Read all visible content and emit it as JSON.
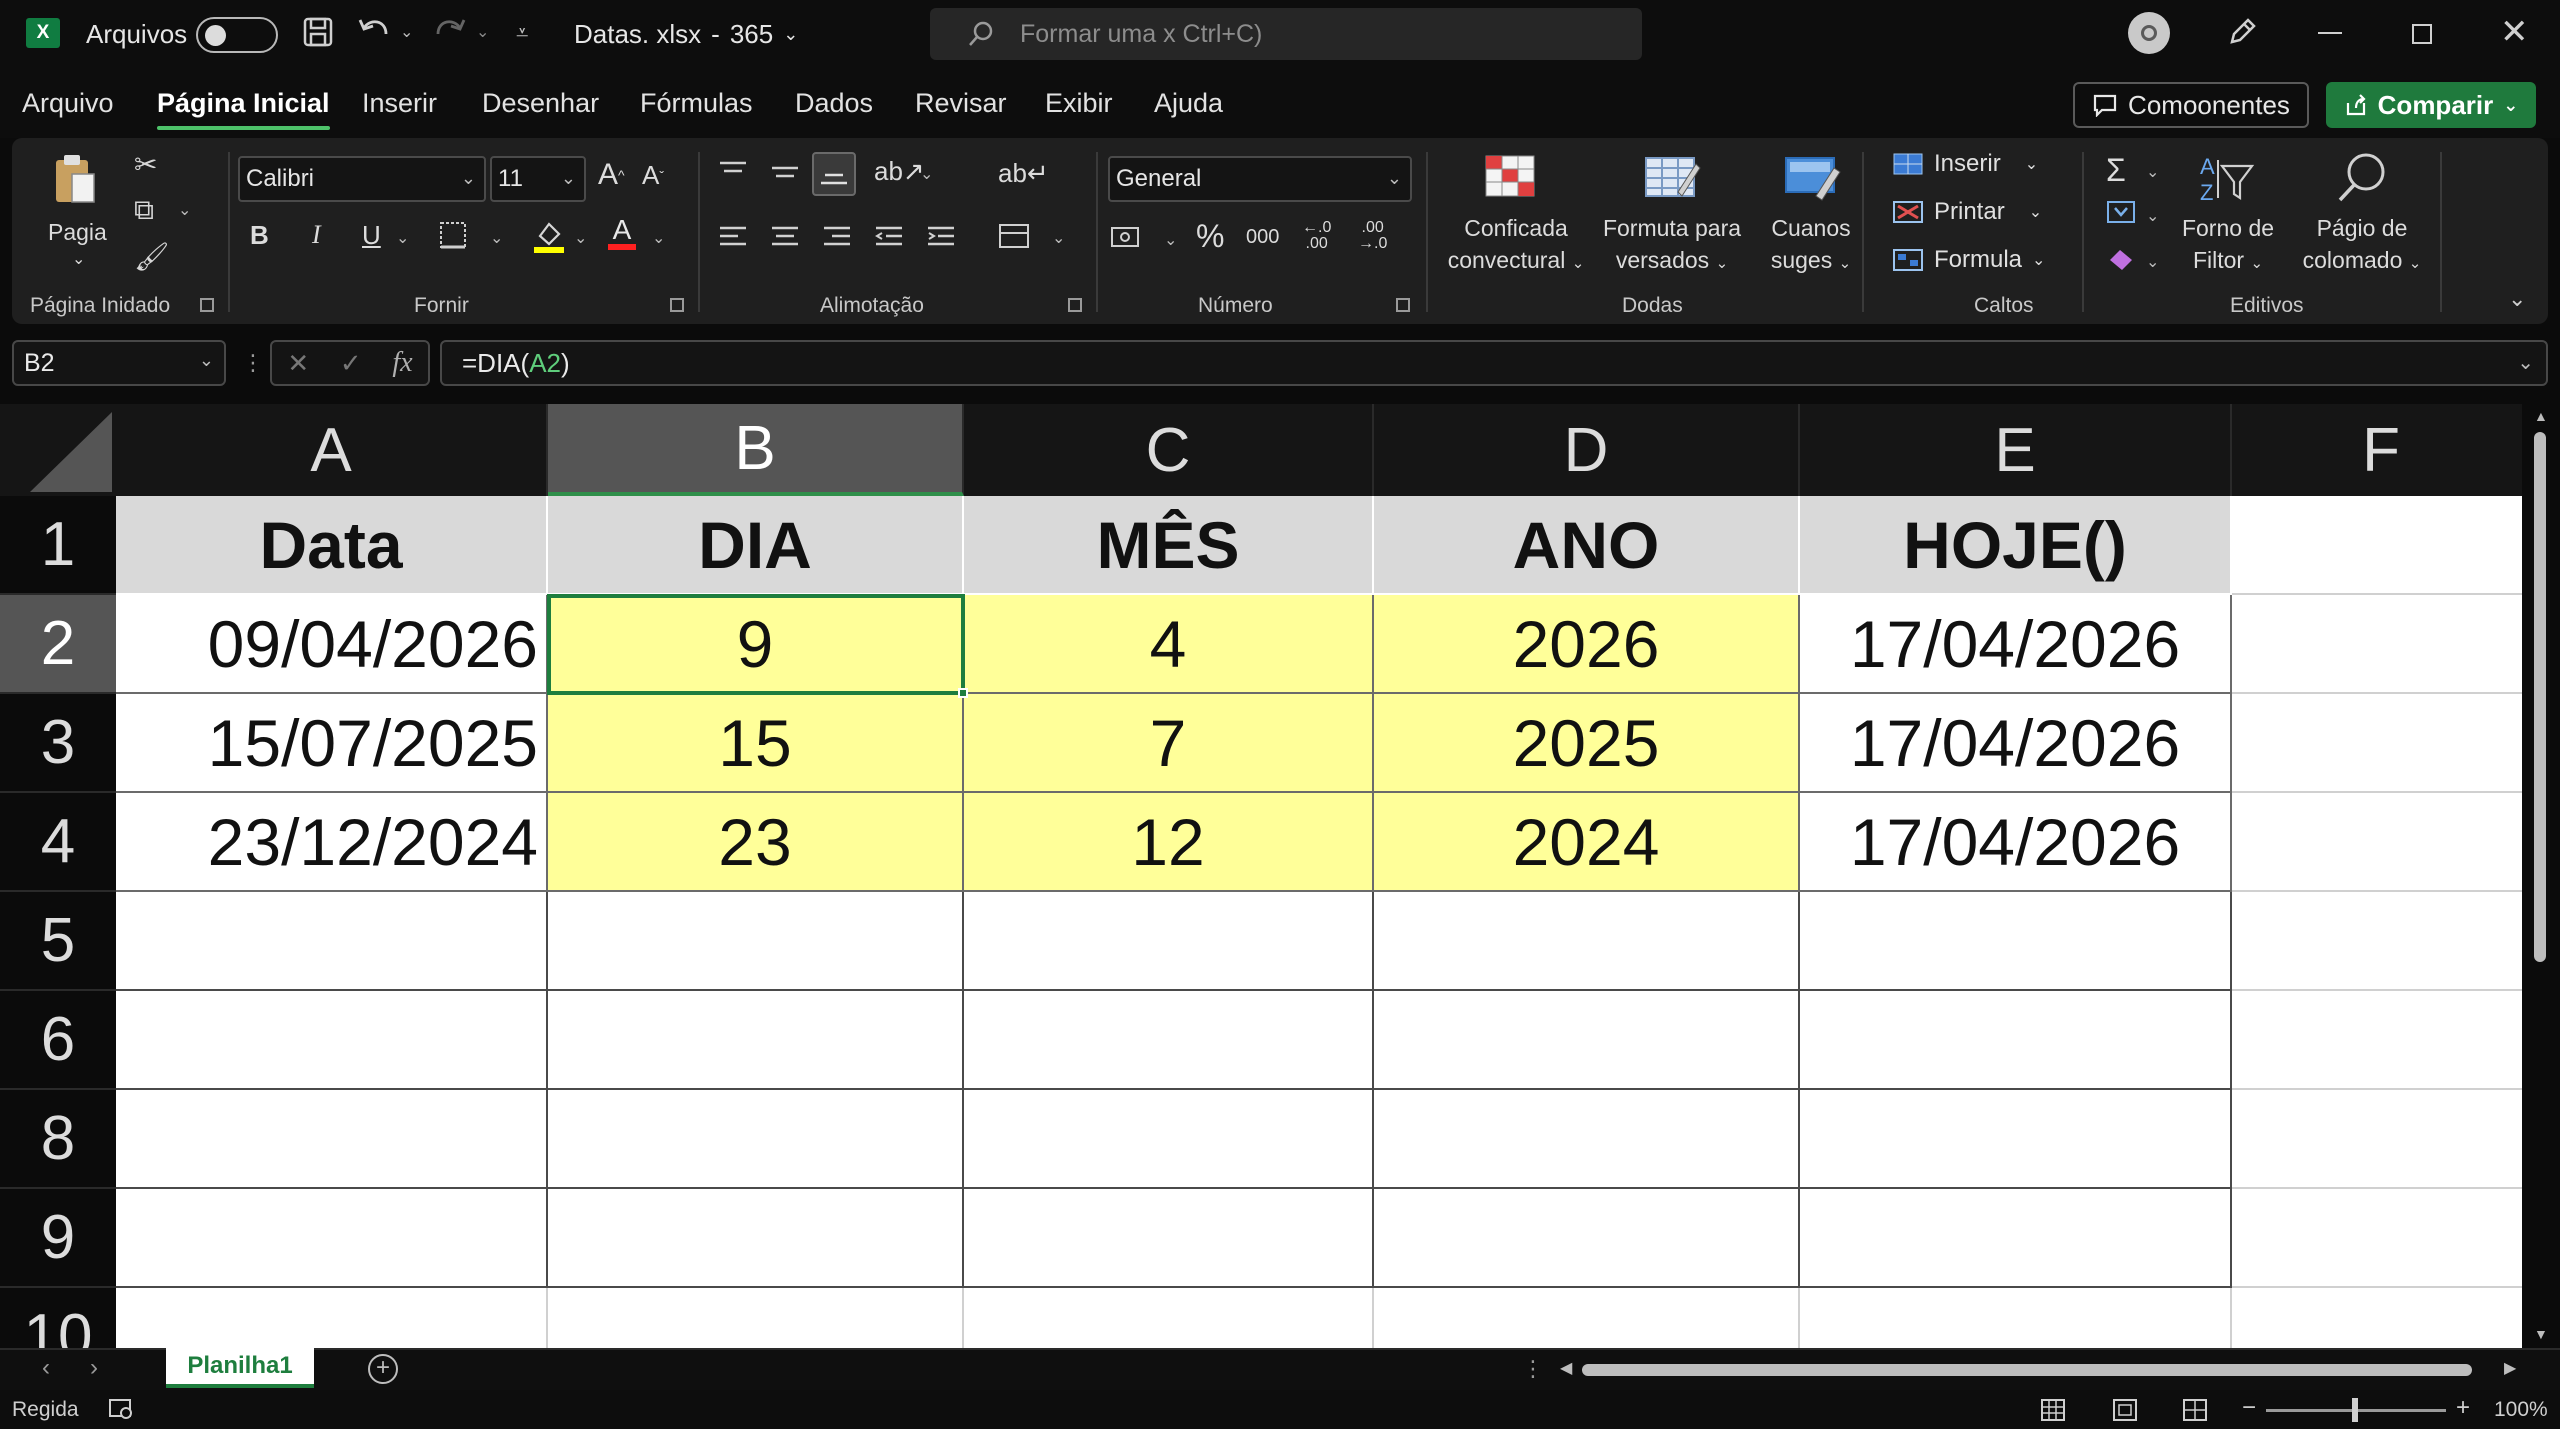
{
  "titlebar": {
    "autosave_label": "Arquivos",
    "doc_name": "Datas. xlsx",
    "separator": "-",
    "doc_suffix": "365",
    "search_placeholder": "Formar uma x Ctrl+C)"
  },
  "menu": {
    "tabs": [
      "Arquivo",
      "Página Inicial",
      "Inserir",
      "Desenhar",
      "Fórmulas",
      "Dados",
      "Revisar",
      "Exibir",
      "Ajuda"
    ],
    "active_tab": "Página Inicial",
    "comments_label": "Comoonentes",
    "share_label": "Comparir"
  },
  "ribbon": {
    "clipboard": {
      "paste_label": "Pagia",
      "group_label": "Página Inidado"
    },
    "font": {
      "name": "Calibri",
      "size": "11",
      "group_label": "Fornir",
      "bold": "B",
      "italic": "I",
      "underline": "U"
    },
    "alignment": {
      "group_label": "Alimotação"
    },
    "number": {
      "format": "General",
      "group_label": "Número",
      "percent": "%",
      "thousands": "000"
    },
    "styles": {
      "conditional_1": "Conficada",
      "conditional_2": "convectural",
      "format_table_1": "Formuta para",
      "format_table_2": "versados",
      "cell_styles_1": "Cuanos",
      "cell_styles_2": "suges",
      "group_label": "Dodas"
    },
    "cells": {
      "insert": "Inserir",
      "delete": "Printar",
      "format": "Formula",
      "group_label": "Caltos"
    },
    "editing": {
      "sort_1": "Forno de",
      "sort_2": "Filtor",
      "find_1": "Págio de",
      "find_2": "colomado",
      "group_label": "Editivos"
    }
  },
  "formula_bar": {
    "name_box": "B2",
    "formula_prefix": "=DIA(",
    "formula_ref": "A2",
    "formula_suffix": ")"
  },
  "sheet": {
    "columns": [
      "A",
      "B",
      "C",
      "D",
      "E",
      "F"
    ],
    "selected_column": "B",
    "rows": [
      "1",
      "2",
      "3",
      "4",
      "5",
      "6",
      "8",
      "9",
      "10"
    ],
    "selected_row": "2",
    "headers": [
      "Data",
      "DIA",
      "MÊS",
      "ANO",
      "HOJE()"
    ],
    "data": [
      [
        "09/04/2026",
        "9",
        "4",
        "2026",
        "17/04/2026"
      ],
      [
        "15/07/2025",
        "15",
        "7",
        "2025",
        "17/04/2026"
      ],
      [
        "23/12/2024",
        "23",
        "12",
        "2024",
        "17/04/2026"
      ]
    ],
    "active_cell": "B2",
    "highlight_color": "#ffff99"
  },
  "sheet_tabs": {
    "tabs": [
      "Planilha1"
    ],
    "active": "Planilha1"
  },
  "statusbar": {
    "mode": "Regida",
    "zoom": "100%"
  }
}
